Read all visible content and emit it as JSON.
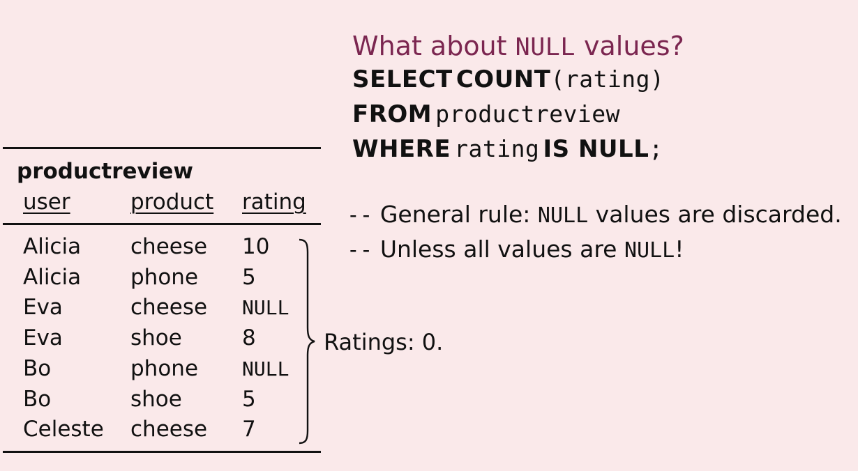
{
  "heading": {
    "prefix": "What about ",
    "null_word": "NULL",
    "suffix": " values?"
  },
  "query": {
    "line1": {
      "kw1": "SELECT",
      "kw2": "COUNT",
      "rest": "(rating)"
    },
    "line2": {
      "kw": "FROM",
      "rest": "productreview"
    },
    "line3": {
      "kw1": "WHERE",
      "mid": "rating",
      "kw2": "IS NULL",
      "end": ";"
    }
  },
  "comments": {
    "line1": {
      "dash": "--",
      "prefix": " General rule: ",
      "null_word": "NULL",
      "suffix": " values are discarded."
    },
    "line2": {
      "dash": "--",
      "prefix": " Unless all values are ",
      "null_word": "NULL",
      "suffix": "!"
    }
  },
  "table": {
    "name": "productreview",
    "columns": [
      "user",
      "product",
      "rating"
    ],
    "rows": [
      [
        "Alicia",
        "cheese",
        "10"
      ],
      [
        "Alicia",
        "phone",
        "5"
      ],
      [
        "Eva",
        "cheese",
        "NULL"
      ],
      [
        "Eva",
        "shoe",
        "8"
      ],
      [
        "Bo",
        "phone",
        "NULL"
      ],
      [
        "Bo",
        "shoe",
        "5"
      ],
      [
        "Celeste",
        "cheese",
        "7"
      ]
    ]
  },
  "result": {
    "label": "Ratings: ",
    "value": "0."
  }
}
